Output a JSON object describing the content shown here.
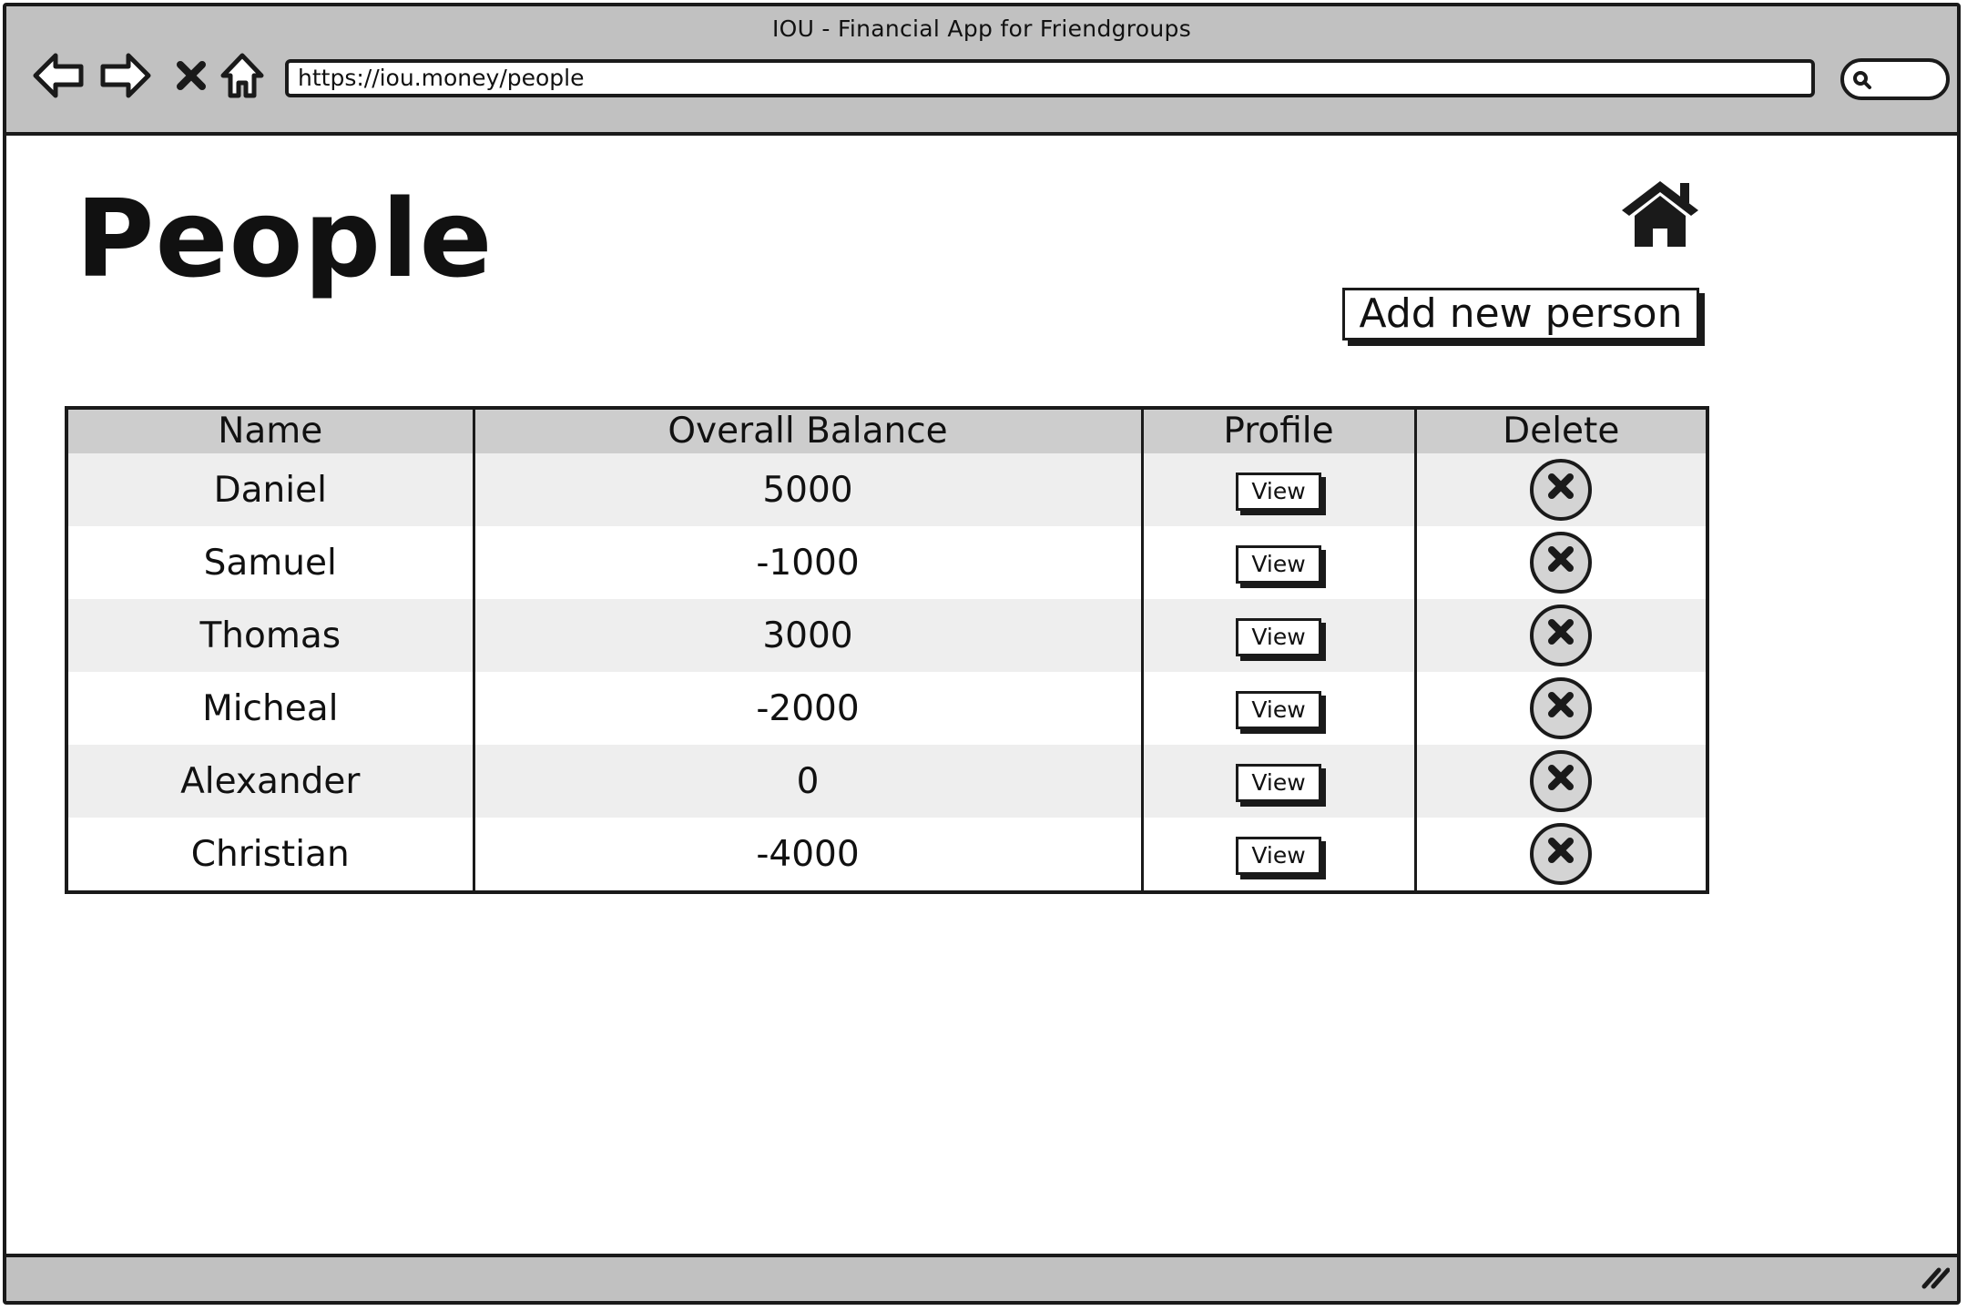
{
  "window": {
    "title": "IOU - Financial App for Friendgroups",
    "url": "https://iou.money/people"
  },
  "nav": {
    "back_icon": "arrow-left-icon",
    "forward_icon": "arrow-right-icon",
    "stop_icon": "close-icon",
    "home_icon": "home-outline-icon",
    "search_icon": "search-icon"
  },
  "page": {
    "title": "People",
    "home_icon": "home-icon",
    "add_button_label": "Add new person"
  },
  "table": {
    "headers": [
      "Name",
      "Overall Balance",
      "Profile",
      "Delete"
    ],
    "view_label": "View",
    "delete_icon": "delete-x-circle-icon",
    "rows": [
      {
        "name": "Daniel",
        "balance": "5000"
      },
      {
        "name": "Samuel",
        "balance": "-1000"
      },
      {
        "name": "Thomas",
        "balance": "3000"
      },
      {
        "name": "Micheal",
        "balance": "-2000"
      },
      {
        "name": "Alexander",
        "balance": "0"
      },
      {
        "name": "Christian",
        "balance": "-4000"
      }
    ]
  },
  "colors": {
    "chrome": "#c1c1c1",
    "header_row": "#cdcdcd",
    "row_alt": "#eeeeee",
    "outline": "#1a1a1a",
    "delete_fill": "#d4d4d4"
  }
}
